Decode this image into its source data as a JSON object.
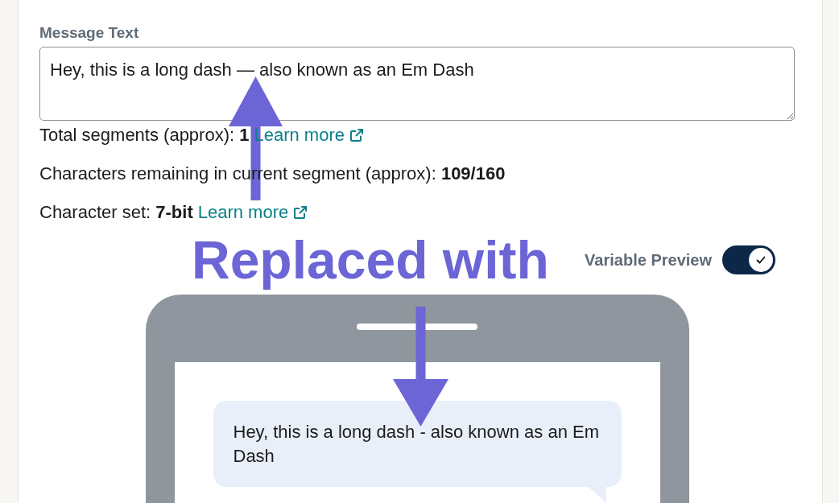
{
  "message_field": {
    "label": "Message Text",
    "value": "Hey, this is a long dash — also known as an Em Dash"
  },
  "stats": [
    {
      "text": "Total segments (approx): **1**",
      "link": "Learn more"
    },
    {
      "text": "Characters remaining in current segment (approx): **109/160**"
    },
    {
      "text": "Character set: **7-bit**",
      "link": "Learn more"
    }
  ],
  "annotation": {
    "text": "Replaced with"
  },
  "variable_preview": {
    "label": "Variable Preview",
    "on": true
  },
  "phone_preview": {
    "message": "Hey, this is a long dash - also known as an Em Dash"
  }
}
